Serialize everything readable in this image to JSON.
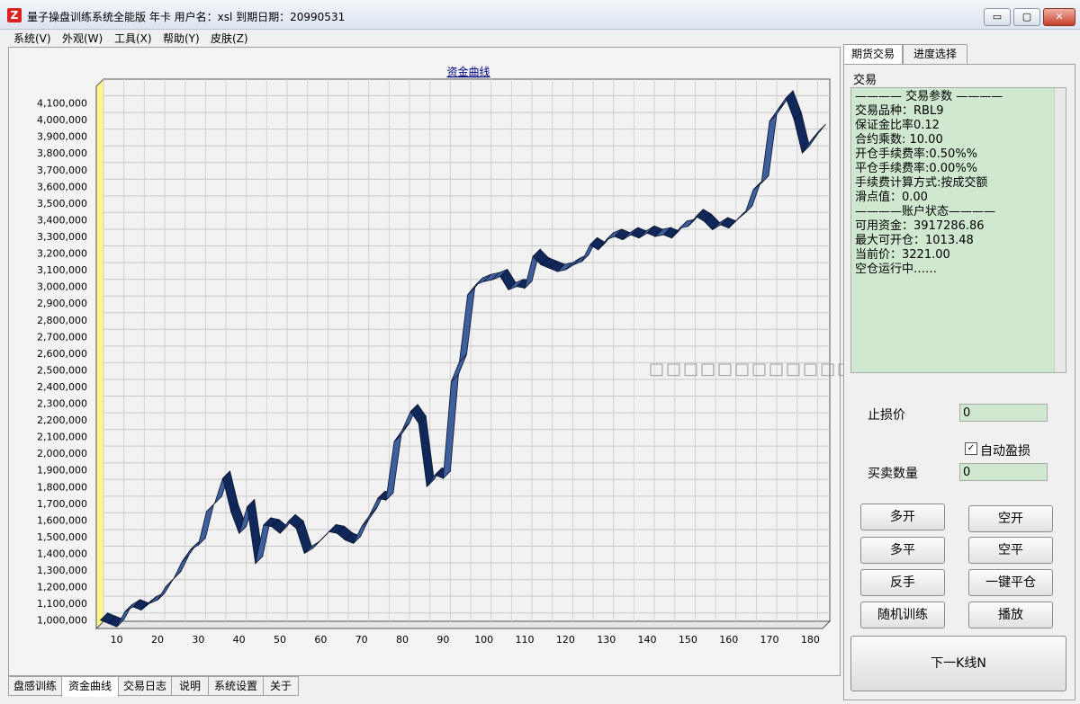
{
  "window": {
    "icon_letter": "Z",
    "title": "量子操盘训练系统全能版 年卡 用户名：xsl 到期日期：20990531",
    "min_label": "▭",
    "max_label": "▢",
    "close_label": "✕"
  },
  "menu": [
    "系统(V)",
    "外观(W)",
    "工具(X)",
    "帮助(Y)",
    "皮肤(Z)"
  ],
  "bottom_tabs": [
    "盘感训练",
    "资金曲线",
    "交易日志",
    "说明",
    "系统设置",
    "关于"
  ],
  "right_tabs": [
    "期货交易",
    "进度选择"
  ],
  "trade": {
    "section_title": "交易",
    "info_lines": [
      "———— 交易参数 ————",
      "交易品种：RBL9",
      "保证金比率0.12",
      " 合约乘数: 10.00",
      "开仓手续费率:0.50%%",
      " 平仓手续费率:0.00%%",
      " 手续费计算方式:按成交额",
      "滑点值：0.00",
      "————账户状态————",
      "可用资金：3917286.86",
      "最大可开仓：1013.48",
      "当前价：3221.00",
      "空仓运行中……"
    ],
    "stop_loss_label": "止损价",
    "stop_loss_value": "0",
    "auto_stop_label": "自动盈损",
    "auto_stop_checked": "✓",
    "qty_label": "买卖数量",
    "qty_value": "0",
    "buttons": [
      "多开",
      "空开",
      "多平",
      "空平",
      "反手",
      "一键平仓",
      "随机训练",
      "播放"
    ],
    "next_button": "下一K线N"
  },
  "ghost_text": "□□□□□□□□□□□□",
  "chart_data": {
    "type": "area",
    "title": "资金曲线",
    "xlabel": "",
    "ylabel": "",
    "xlim": [
      5,
      183
    ],
    "ylim": [
      950000,
      4200000
    ],
    "x_ticks": [
      10,
      20,
      30,
      40,
      50,
      60,
      70,
      80,
      90,
      100,
      110,
      120,
      130,
      140,
      150,
      160,
      170,
      180
    ],
    "y_ticks": [
      1000000,
      1100000,
      1200000,
      1300000,
      1400000,
      1500000,
      1600000,
      1700000,
      1800000,
      1900000,
      2000000,
      2100000,
      2200000,
      2300000,
      2400000,
      2500000,
      2600000,
      2700000,
      2800000,
      2900000,
      3000000,
      3100000,
      3200000,
      3300000,
      3400000,
      3500000,
      3600000,
      3700000,
      3800000,
      3900000,
      4000000,
      4100000
    ],
    "y_tick_labels": [
      "1,000,000",
      "1,100,000",
      "1,200,000",
      "1,300,000",
      "1,400,000",
      "1,500,000",
      "1,600,000",
      "1,700,000",
      "1,800,000",
      "1,900,000",
      "2,000,000",
      "2,100,000",
      "2,200,000",
      "2,300,000",
      "2,400,000",
      "2,500,000",
      "2,600,000",
      "2,700,000",
      "2,800,000",
      "2,900,000",
      "3,000,000",
      "3,100,000",
      "3,200,000",
      "3,300,000",
      "3,400,000",
      "3,500,000",
      "3,600,000",
      "3,700,000",
      "3,800,000",
      "3,900,000",
      "4,000,000",
      "4,100,000"
    ],
    "grid": true,
    "series": [
      {
        "x": [
          6,
          8,
          10,
          12,
          14,
          16,
          18,
          20,
          22,
          24,
          26,
          28,
          30,
          32,
          34,
          36,
          38,
          40,
          42,
          44,
          46,
          48,
          50,
          52,
          54,
          56,
          58,
          60,
          62,
          64,
          66,
          68,
          70,
          72,
          74,
          76,
          78,
          80,
          82,
          84,
          86,
          88,
          90,
          92,
          94,
          96,
          98,
          100,
          102,
          104,
          106,
          108,
          110,
          112,
          114,
          116,
          118,
          120,
          122,
          124,
          126,
          128,
          130,
          132,
          134,
          136,
          138,
          140,
          142,
          144,
          146,
          148,
          150,
          152,
          154,
          156,
          158,
          160,
          162,
          164,
          166,
          168,
          170,
          172,
          174,
          176,
          178,
          180,
          182
        ],
        "values": [
          1000000,
          980000,
          960000,
          1050000,
          1080000,
          1060000,
          1100000,
          1120000,
          1200000,
          1250000,
          1350000,
          1420000,
          1450000,
          1650000,
          1700000,
          1850000,
          1650000,
          1520000,
          1680000,
          1340000,
          1570000,
          1560000,
          1520000,
          1590000,
          1550000,
          1400000,
          1430000,
          1480000,
          1530000,
          1520000,
          1480000,
          1460000,
          1560000,
          1630000,
          1730000,
          1720000,
          2070000,
          2140000,
          2250000,
          2180000,
          1800000,
          1870000,
          1850000,
          2430000,
          2550000,
          2950000,
          3010000,
          3030000,
          3040000,
          3060000,
          2980000,
          3000000,
          2990000,
          3180000,
          3130000,
          3110000,
          3090000,
          3100000,
          3130000,
          3150000,
          3250000,
          3220000,
          3280000,
          3300000,
          3280000,
          3310000,
          3290000,
          3320000,
          3300000,
          3310000,
          3290000,
          3350000,
          3360000,
          3420000,
          3390000,
          3340000,
          3370000,
          3350000,
          3400000,
          3440000,
          3580000,
          3620000,
          3990000,
          4060000,
          4130000,
          4000000,
          3800000,
          3870000,
          3930000
        ]
      }
    ]
  }
}
